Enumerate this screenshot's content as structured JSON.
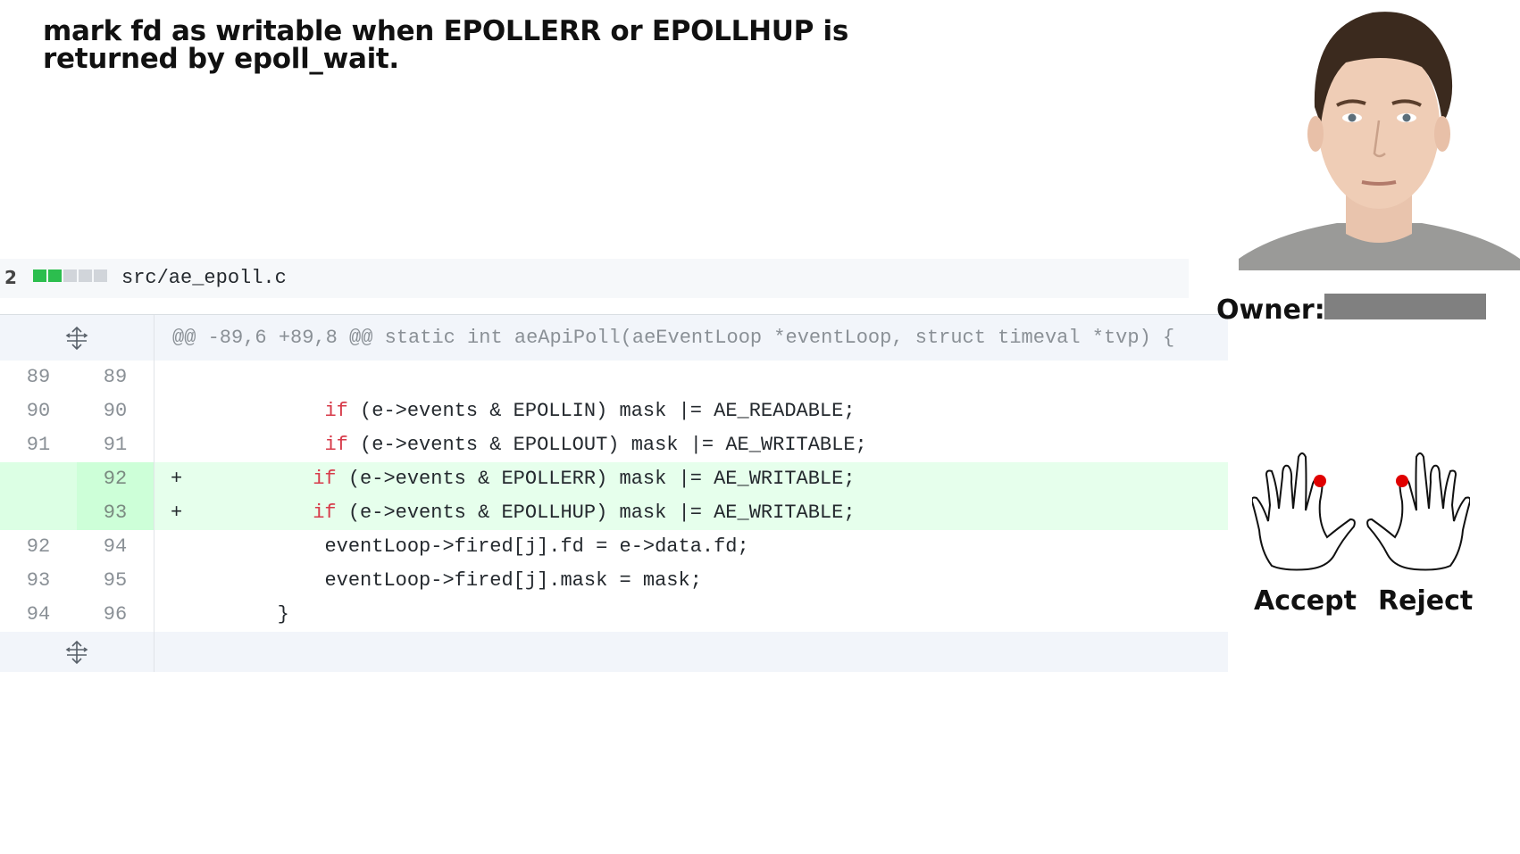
{
  "title": "mark fd as writable when EPOLLERR or EPOLLHUP is returned by epoll_wait.",
  "file": {
    "changes": "2",
    "name": "src/ae_epoll.c",
    "diffstat_colors": [
      "#2cbe4e",
      "#2cbe4e",
      "#d1d5da",
      "#d1d5da",
      "#d1d5da"
    ]
  },
  "hunk_header": "@@ -89,6 +89,8 @@ static int aeApiPoll(aeEventLoop *eventLoop, struct timeval *tvp) {",
  "lines": [
    {
      "old": "89",
      "new": "89",
      "marker": "",
      "indent": "",
      "kw": "",
      "rest": "",
      "type": "context"
    },
    {
      "old": "90",
      "new": "90",
      "marker": "",
      "indent": "            ",
      "kw": "if",
      "rest": " (e->events & EPOLLIN) mask |= AE_READABLE;",
      "type": "context"
    },
    {
      "old": "91",
      "new": "91",
      "marker": "",
      "indent": "            ",
      "kw": "if",
      "rest": " (e->events & EPOLLOUT) mask |= AE_WRITABLE;",
      "type": "context"
    },
    {
      "old": "",
      "new": "92",
      "marker": "+",
      "indent": "           ",
      "kw": "if",
      "rest": " (e->events & EPOLLERR) mask |= AE_WRITABLE;",
      "type": "add"
    },
    {
      "old": "",
      "new": "93",
      "marker": "+",
      "indent": "           ",
      "kw": "if",
      "rest": " (e->events & EPOLLHUP) mask |= AE_WRITABLE;",
      "type": "add"
    },
    {
      "old": "92",
      "new": "94",
      "marker": "",
      "indent": "            ",
      "kw": "",
      "rest": "eventLoop->fired[j].fd = e->data.fd;",
      "type": "context"
    },
    {
      "old": "93",
      "new": "95",
      "marker": "",
      "indent": "            ",
      "kw": "",
      "rest": "eventLoop->fired[j].mask = mask;",
      "type": "context"
    },
    {
      "old": "94",
      "new": "96",
      "marker": "",
      "indent": "        ",
      "kw": "",
      "rest": "}",
      "type": "context"
    }
  ],
  "owner": {
    "label": "Owner:"
  },
  "buttons": {
    "accept": "Accept",
    "reject": "Reject"
  },
  "icons": {
    "expand": "expand-arrows-icon",
    "photo": "person-photo",
    "hand": "hand-icon"
  },
  "colors": {
    "addition_bg": "#e6ffec",
    "keyword": "#d73a49",
    "marker_dot": "#e00000",
    "owner_redacted": "#808080"
  }
}
